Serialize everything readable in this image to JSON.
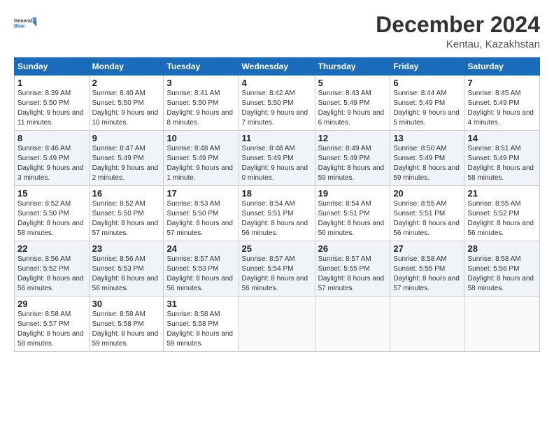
{
  "header": {
    "logo_general": "General",
    "logo_blue": "Blue",
    "month_title": "December 2024",
    "location": "Kentau, Kazakhstan"
  },
  "days_of_week": [
    "Sunday",
    "Monday",
    "Tuesday",
    "Wednesday",
    "Thursday",
    "Friday",
    "Saturday"
  ],
  "weeks": [
    [
      {
        "day": "1",
        "sunrise": "Sunrise: 8:39 AM",
        "sunset": "Sunset: 5:50 PM",
        "daylight": "Daylight: 9 hours and 11 minutes."
      },
      {
        "day": "2",
        "sunrise": "Sunrise: 8:40 AM",
        "sunset": "Sunset: 5:50 PM",
        "daylight": "Daylight: 9 hours and 10 minutes."
      },
      {
        "day": "3",
        "sunrise": "Sunrise: 8:41 AM",
        "sunset": "Sunset: 5:50 PM",
        "daylight": "Daylight: 9 hours and 8 minutes."
      },
      {
        "day": "4",
        "sunrise": "Sunrise: 8:42 AM",
        "sunset": "Sunset: 5:50 PM",
        "daylight": "Daylight: 9 hours and 7 minutes."
      },
      {
        "day": "5",
        "sunrise": "Sunrise: 8:43 AM",
        "sunset": "Sunset: 5:49 PM",
        "daylight": "Daylight: 9 hours and 6 minutes."
      },
      {
        "day": "6",
        "sunrise": "Sunrise: 8:44 AM",
        "sunset": "Sunset: 5:49 PM",
        "daylight": "Daylight: 9 hours and 5 minutes."
      },
      {
        "day": "7",
        "sunrise": "Sunrise: 8:45 AM",
        "sunset": "Sunset: 5:49 PM",
        "daylight": "Daylight: 9 hours and 4 minutes."
      }
    ],
    [
      {
        "day": "8",
        "sunrise": "Sunrise: 8:46 AM",
        "sunset": "Sunset: 5:49 PM",
        "daylight": "Daylight: 9 hours and 3 minutes."
      },
      {
        "day": "9",
        "sunrise": "Sunrise: 8:47 AM",
        "sunset": "Sunset: 5:49 PM",
        "daylight": "Daylight: 9 hours and 2 minutes."
      },
      {
        "day": "10",
        "sunrise": "Sunrise: 8:48 AM",
        "sunset": "Sunset: 5:49 PM",
        "daylight": "Daylight: 9 hours and 1 minute."
      },
      {
        "day": "11",
        "sunrise": "Sunrise: 8:48 AM",
        "sunset": "Sunset: 5:49 PM",
        "daylight": "Daylight: 9 hours and 0 minutes."
      },
      {
        "day": "12",
        "sunrise": "Sunrise: 8:49 AM",
        "sunset": "Sunset: 5:49 PM",
        "daylight": "Daylight: 8 hours and 59 minutes."
      },
      {
        "day": "13",
        "sunrise": "Sunrise: 8:50 AM",
        "sunset": "Sunset: 5:49 PM",
        "daylight": "Daylight: 8 hours and 59 minutes."
      },
      {
        "day": "14",
        "sunrise": "Sunrise: 8:51 AM",
        "sunset": "Sunset: 5:49 PM",
        "daylight": "Daylight: 8 hours and 58 minutes."
      }
    ],
    [
      {
        "day": "15",
        "sunrise": "Sunrise: 8:52 AM",
        "sunset": "Sunset: 5:50 PM",
        "daylight": "Daylight: 8 hours and 58 minutes."
      },
      {
        "day": "16",
        "sunrise": "Sunrise: 8:52 AM",
        "sunset": "Sunset: 5:50 PM",
        "daylight": "Daylight: 8 hours and 57 minutes."
      },
      {
        "day": "17",
        "sunrise": "Sunrise: 8:53 AM",
        "sunset": "Sunset: 5:50 PM",
        "daylight": "Daylight: 8 hours and 57 minutes."
      },
      {
        "day": "18",
        "sunrise": "Sunrise: 8:54 AM",
        "sunset": "Sunset: 5:51 PM",
        "daylight": "Daylight: 8 hours and 56 minutes."
      },
      {
        "day": "19",
        "sunrise": "Sunrise: 8:54 AM",
        "sunset": "Sunset: 5:51 PM",
        "daylight": "Daylight: 8 hours and 56 minutes."
      },
      {
        "day": "20",
        "sunrise": "Sunrise: 8:55 AM",
        "sunset": "Sunset: 5:51 PM",
        "daylight": "Daylight: 8 hours and 56 minutes."
      },
      {
        "day": "21",
        "sunrise": "Sunrise: 8:55 AM",
        "sunset": "Sunset: 5:52 PM",
        "daylight": "Daylight: 8 hours and 56 minutes."
      }
    ],
    [
      {
        "day": "22",
        "sunrise": "Sunrise: 8:56 AM",
        "sunset": "Sunset: 5:52 PM",
        "daylight": "Daylight: 8 hours and 56 minutes."
      },
      {
        "day": "23",
        "sunrise": "Sunrise: 8:56 AM",
        "sunset": "Sunset: 5:53 PM",
        "daylight": "Daylight: 8 hours and 56 minutes."
      },
      {
        "day": "24",
        "sunrise": "Sunrise: 8:57 AM",
        "sunset": "Sunset: 5:53 PM",
        "daylight": "Daylight: 8 hours and 56 minutes."
      },
      {
        "day": "25",
        "sunrise": "Sunrise: 8:57 AM",
        "sunset": "Sunset: 5:54 PM",
        "daylight": "Daylight: 8 hours and 56 minutes."
      },
      {
        "day": "26",
        "sunrise": "Sunrise: 8:57 AM",
        "sunset": "Sunset: 5:55 PM",
        "daylight": "Daylight: 8 hours and 57 minutes."
      },
      {
        "day": "27",
        "sunrise": "Sunrise: 8:58 AM",
        "sunset": "Sunset: 5:55 PM",
        "daylight": "Daylight: 8 hours and 57 minutes."
      },
      {
        "day": "28",
        "sunrise": "Sunrise: 8:58 AM",
        "sunset": "Sunset: 5:56 PM",
        "daylight": "Daylight: 8 hours and 58 minutes."
      }
    ],
    [
      {
        "day": "29",
        "sunrise": "Sunrise: 8:58 AM",
        "sunset": "Sunset: 5:57 PM",
        "daylight": "Daylight: 8 hours and 58 minutes."
      },
      {
        "day": "30",
        "sunrise": "Sunrise: 8:58 AM",
        "sunset": "Sunset: 5:58 PM",
        "daylight": "Daylight: 8 hours and 59 minutes."
      },
      {
        "day": "31",
        "sunrise": "Sunrise: 8:58 AM",
        "sunset": "Sunset: 5:58 PM",
        "daylight": "Daylight: 8 hours and 59 minutes."
      },
      null,
      null,
      null,
      null
    ]
  ]
}
